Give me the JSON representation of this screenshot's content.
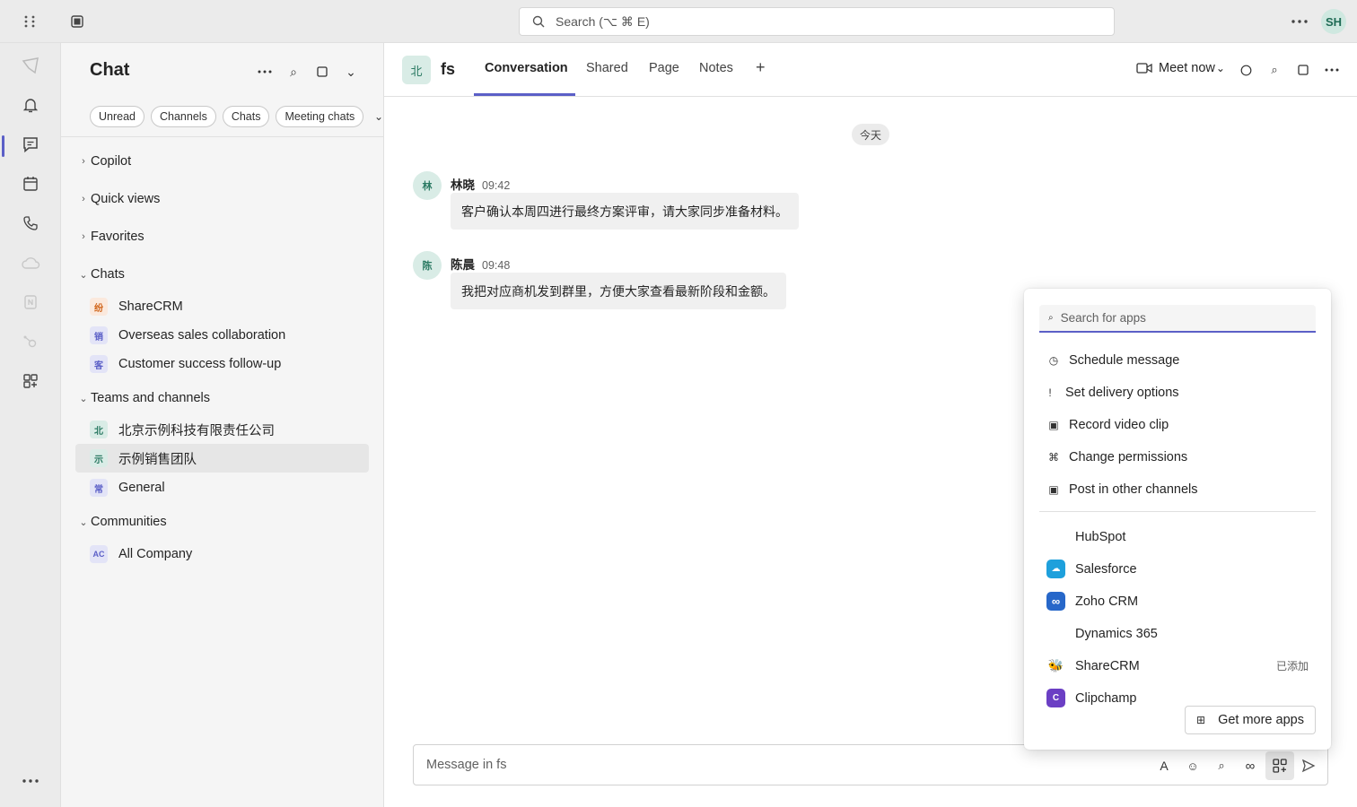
{
  "topbar": {
    "search_placeholder": "Search (⌥ ⌘ E)",
    "user_initials": "SH"
  },
  "sidebar": {
    "title": "Chat",
    "filters": [
      "Unread",
      "Channels",
      "Chats",
      "Meeting chats"
    ],
    "sections": {
      "copilot": "Copilot",
      "quick_views": "Quick views",
      "favorites": "Favorites",
      "chats": "Chats",
      "teams": "Teams and channels",
      "communities": "Communities"
    },
    "chats": [
      {
        "badge": "纷",
        "label": "ShareCRM"
      },
      {
        "badge": "销",
        "label": "Overseas sales collaboration"
      },
      {
        "badge": "客",
        "label": "Customer success follow-up"
      }
    ],
    "teams": [
      {
        "badge": "北",
        "label": "北京示例科技有限责任公司"
      },
      {
        "badge": "示",
        "label": "示例销售团队"
      },
      {
        "badge": "常",
        "label": "General"
      }
    ],
    "communities": [
      {
        "badge": "AC",
        "label": "All Company"
      }
    ]
  },
  "channel": {
    "badge": "北",
    "name": "fs",
    "tabs": [
      "Conversation",
      "Shared",
      "Page",
      "Notes"
    ],
    "add_tab": "+",
    "meet_label": "Meet now"
  },
  "conversation": {
    "date_divider": "今天",
    "messages": [
      {
        "avatar": "林",
        "sender": "林晓",
        "time": "09:42",
        "text": "客户确认本周四进行最终方案评审，请大家同步准备材料。"
      },
      {
        "avatar": "陈",
        "sender": "陈晨",
        "time": "09:48",
        "text": "我把对应商机发到群里，方便大家查看最新阶段和金额。"
      }
    ]
  },
  "compose": {
    "placeholder": "Message in fs",
    "format_icon_text": "A"
  },
  "apps_popup": {
    "search_placeholder": "Search for apps",
    "options": [
      {
        "icon": "◷",
        "label": "Schedule message"
      },
      {
        "icon": "!",
        "label": "Set delivery options"
      },
      {
        "icon": "▣",
        "label": "Record video clip"
      },
      {
        "icon": "⌘",
        "label": "Change permissions"
      },
      {
        "icon": "▣",
        "label": "Post in other channels"
      }
    ],
    "apps": [
      {
        "logo": "",
        "label": "HubSpot",
        "color": "transparent",
        "note": ""
      },
      {
        "logo": "☁",
        "label": "Salesforce",
        "color": "#1ea0dc",
        "note": ""
      },
      {
        "logo": "∞",
        "label": "Zoho CRM",
        "color": "#2767c9",
        "note": ""
      },
      {
        "logo": "",
        "label": "Dynamics 365",
        "color": "transparent",
        "note": ""
      },
      {
        "logo": "🐝",
        "label": "ShareCRM",
        "color": "transparent",
        "note": "已添加"
      },
      {
        "logo": "C",
        "label": "Clipchamp",
        "color": "#6b3fc4",
        "note": ""
      }
    ],
    "get_more": "Get more apps"
  },
  "colors": {
    "accent": "#5b5fc7",
    "teal_badge": "#d9ece6"
  }
}
